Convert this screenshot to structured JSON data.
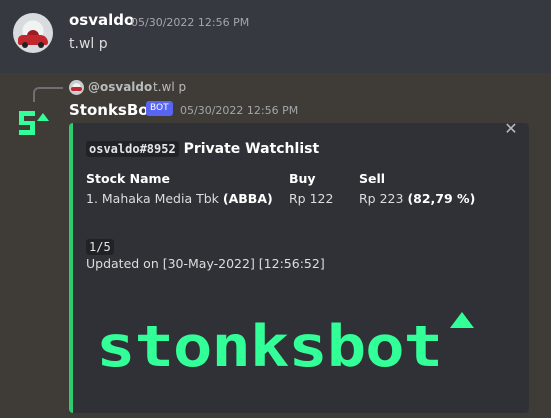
{
  "message1": {
    "author": "osvaldo",
    "timestamp": "05/30/2022 12:56 PM",
    "content": "t.wl p"
  },
  "reply": {
    "mention": "@osvaldo",
    "content": "t.wl p"
  },
  "message2": {
    "author": "StonksBot",
    "bot_tag": "BOT",
    "timestamp": "05/30/2022 12:56 PM"
  },
  "embed": {
    "user_code": "osvaldo#8952",
    "title": "Private Watchlist",
    "columns": [
      "Stock Name",
      "Buy",
      "Sell"
    ],
    "row": {
      "name_prefix": "1. Mahaka Media Tbk ",
      "ticker": "(ABBA)",
      "buy": "Rp 122",
      "sell_value": "Rp 223 ",
      "sell_pct": "(82,79 %)"
    },
    "page": "1/5",
    "updated": "Updated on [30-May-2022] [12:56:52]",
    "logo_text": "stonksbot"
  },
  "colors": {
    "accent": "#2ecc71",
    "logo": "#33ff99",
    "bot_tag": "#5865f2"
  }
}
